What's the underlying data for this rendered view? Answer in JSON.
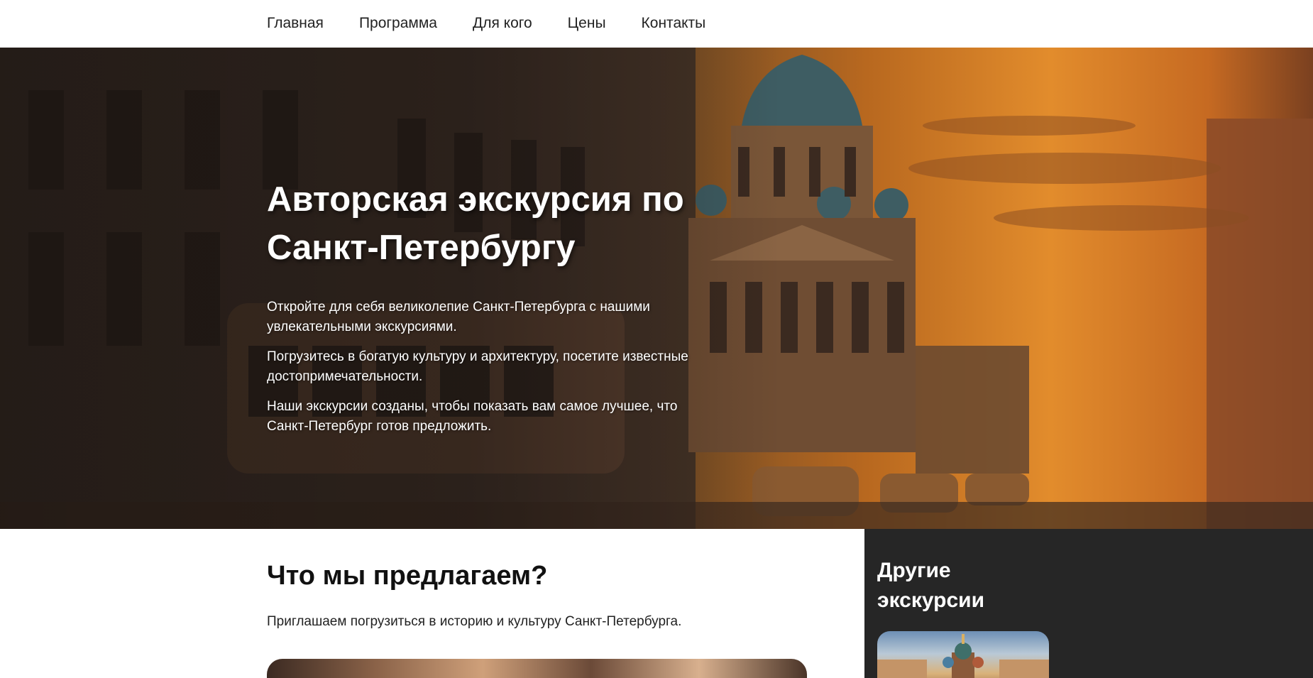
{
  "nav": {
    "items": [
      "Главная",
      "Программа",
      "Для кого",
      "Цены",
      "Контакты"
    ]
  },
  "hero": {
    "title_line1": "Авторская экскурсия по",
    "title_line2": "Санкт-Петербургу",
    "paragraphs": [
      "Откройте для себя великолепие Санкт-Петербурга с нашими увлекательными экскурсиями.",
      "Погрузитесь в богатую культуру и архитектуру, посетите известные достопримечательности.",
      "Наши экскурсии созданы, чтобы показать вам самое лучшее, что Санкт-Петербург готов предложить."
    ]
  },
  "offer": {
    "title": "Что мы предлагаем?",
    "text": "Приглашаем погрузиться в историю и культуру Санкт-Петербурга."
  },
  "sidebar": {
    "title": "Другие экскурсии"
  },
  "colors": {
    "sidebar_bg": "#262626",
    "sunset_accent": "#e28c2c"
  }
}
